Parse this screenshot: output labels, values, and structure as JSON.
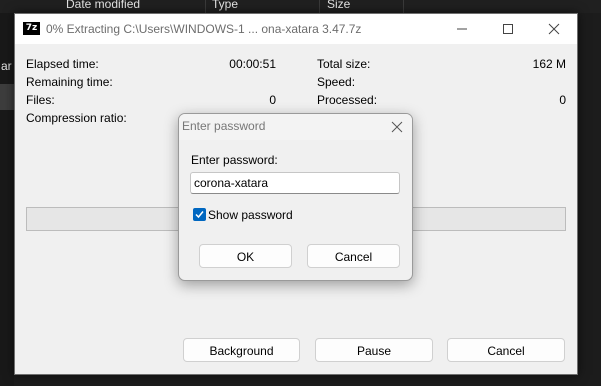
{
  "explorer": {
    "columns": [
      "",
      "Date modified",
      "Type",
      "Size"
    ],
    "nav_fragment": "ar"
  },
  "window": {
    "icon_text": "7z",
    "title": "0% Extracting C:\\Users\\WINDOWS-1 ... ona-xatara 3.47.7z",
    "minimize_icon": "minimize-icon",
    "maximize_icon": "maximize-icon",
    "close_icon": "close-icon"
  },
  "stats": {
    "elapsed_label": "Elapsed time:",
    "elapsed_value": "00:00:51",
    "remaining_label": "Remaining time:",
    "files_label": "Files:",
    "files_value": "0",
    "ratio_label": "Compression ratio:",
    "total_label": "Total size:",
    "total_value": "162 M",
    "speed_label": "Speed:",
    "processed_label": "Processed:",
    "processed_value": "0"
  },
  "progress": {
    "percent": 0,
    "fill_color": "#06b025"
  },
  "buttons": {
    "background": "Background",
    "pause": "Pause",
    "cancel": "Cancel"
  },
  "password_dialog": {
    "title": "Enter password",
    "label": "Enter password:",
    "value": "corona-xatara",
    "show_password_label": "Show password",
    "show_password_checked": true,
    "ok": "OK",
    "cancel": "Cancel",
    "accent": "#0067c0"
  }
}
